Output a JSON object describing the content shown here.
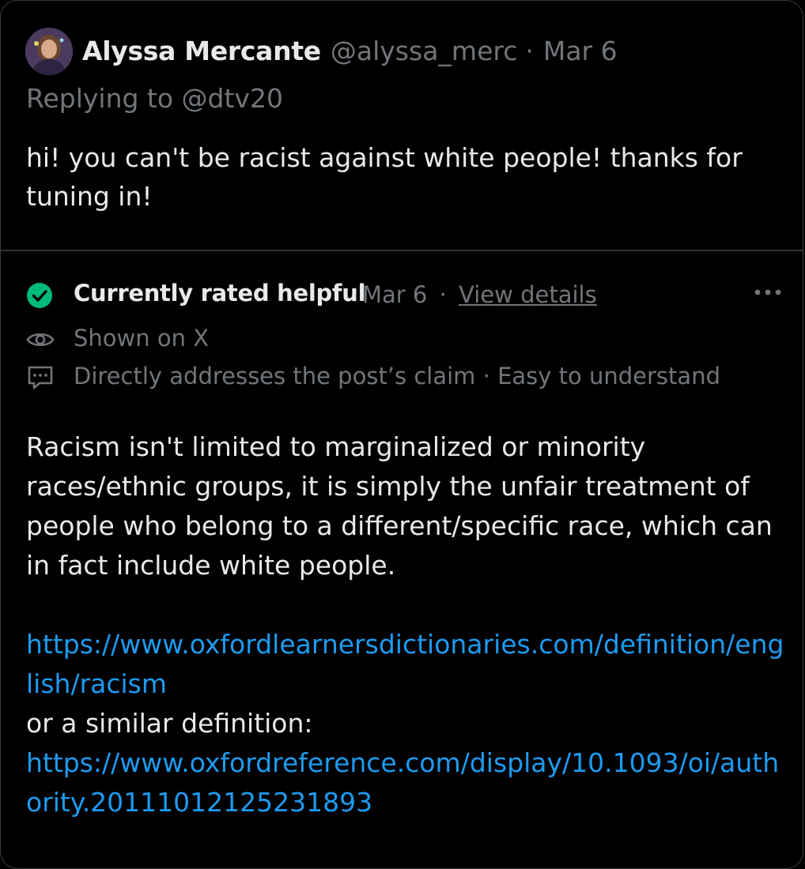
{
  "post": {
    "author_name": "Alyssa Mercante",
    "author_handle": "@alyssa_merc",
    "separator": "·",
    "date": "Mar 6",
    "replying_to": "Replying to @dtv20",
    "text": "hi! you can't be racist against white people! thanks for tuning in!"
  },
  "note": {
    "status": "Currently rated helpful",
    "date": "Mar 6",
    "separator": "·",
    "view_details": "View details",
    "shown_on": "Shown on X",
    "reasons": "Directly addresses the post’s claim · Easy to understand",
    "body_paragraph": "Racism isn't limited to marginalized or minority races/ethnic groups, it is simply the unfair treatment of people who belong to a different/specific race, which can in fact include white people.",
    "link1": "https://www.oxfordlearnersdictionaries.com/definition/english/racism",
    "connector": "or a similar definition:",
    "link2": "https://www.oxfordreference.com/display/10.1093/oi/authority.20111012125231893"
  },
  "icons": {
    "check": "check-circle-icon",
    "eye": "eye-icon",
    "comment": "comment-icon",
    "more": "more-options-icon"
  },
  "colors": {
    "background": "#000000",
    "primary_text": "#e7e9ea",
    "secondary_text": "#71767b",
    "link": "#1d9bf0",
    "helpful_green": "#00ba7c",
    "border": "#2f3336"
  }
}
